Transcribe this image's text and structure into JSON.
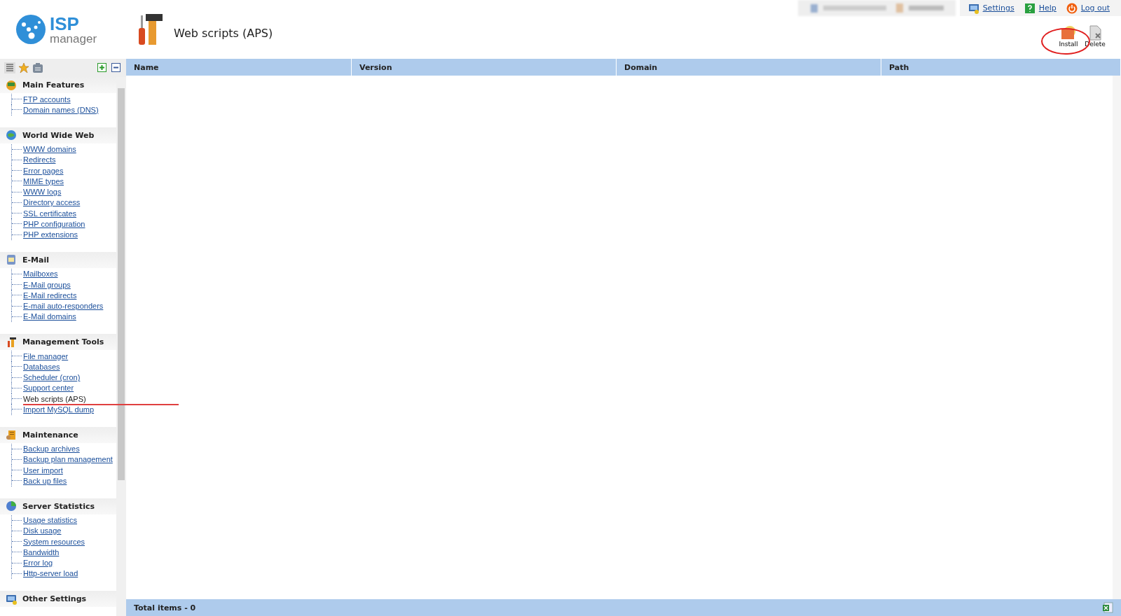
{
  "header": {
    "logo": {
      "title": "ISP",
      "subtitle": "manager"
    },
    "page_title": "Web scripts (APS)",
    "links": [
      "Settings",
      "Help",
      "Log out"
    ]
  },
  "toolbar": {
    "buttons": [
      "Install",
      "Delete"
    ]
  },
  "sidebar": {
    "sections": [
      {
        "title": "Main Features",
        "items": [
          {
            "label": "FTP accounts",
            "selected": false
          },
          {
            "label": "Domain names (DNS)",
            "selected": false
          }
        ]
      },
      {
        "title": "World Wide Web",
        "items": [
          {
            "label": "WWW domains",
            "selected": false
          },
          {
            "label": "Redirects",
            "selected": false
          },
          {
            "label": "Error pages",
            "selected": false
          },
          {
            "label": "MIME types",
            "selected": false
          },
          {
            "label": "WWW logs",
            "selected": false
          },
          {
            "label": "Directory access",
            "selected": false
          },
          {
            "label": "SSL certificates",
            "selected": false
          },
          {
            "label": "PHP configuration",
            "selected": false
          },
          {
            "label": "PHP extensions",
            "selected": false
          }
        ]
      },
      {
        "title": "E-Mail",
        "items": [
          {
            "label": "Mailboxes",
            "selected": false
          },
          {
            "label": "E-Mail groups",
            "selected": false
          },
          {
            "label": "E-Mail redirects",
            "selected": false
          },
          {
            "label": "E-mail auto-responders",
            "selected": false
          },
          {
            "label": "E-Mail domains",
            "selected": false
          }
        ]
      },
      {
        "title": "Management Tools",
        "items": [
          {
            "label": "File manager",
            "selected": false
          },
          {
            "label": "Databases",
            "selected": false
          },
          {
            "label": "Scheduler (cron)",
            "selected": false
          },
          {
            "label": "Support center",
            "selected": false
          },
          {
            "label": "Web scripts (APS)",
            "selected": true
          },
          {
            "label": "Import MySQL dump",
            "selected": false
          }
        ]
      },
      {
        "title": "Maintenance",
        "items": [
          {
            "label": "Backup archives",
            "selected": false
          },
          {
            "label": "Backup plan management",
            "selected": false
          },
          {
            "label": "User import",
            "selected": false
          },
          {
            "label": "Back up files",
            "selected": false
          }
        ]
      },
      {
        "title": "Server Statistics",
        "items": [
          {
            "label": "Usage statistics",
            "selected": false
          },
          {
            "label": "Disk usage",
            "selected": false
          },
          {
            "label": "System resources",
            "selected": false
          },
          {
            "label": "Bandwidth",
            "selected": false
          },
          {
            "label": "Error log",
            "selected": false
          },
          {
            "label": "Http-server load",
            "selected": false
          }
        ]
      },
      {
        "title": "Other Settings"
      }
    ]
  },
  "table": {
    "columns": [
      "Name",
      "Version",
      "Domain",
      "Path"
    ]
  },
  "status_bar": {
    "total": "Total items - 0"
  }
}
